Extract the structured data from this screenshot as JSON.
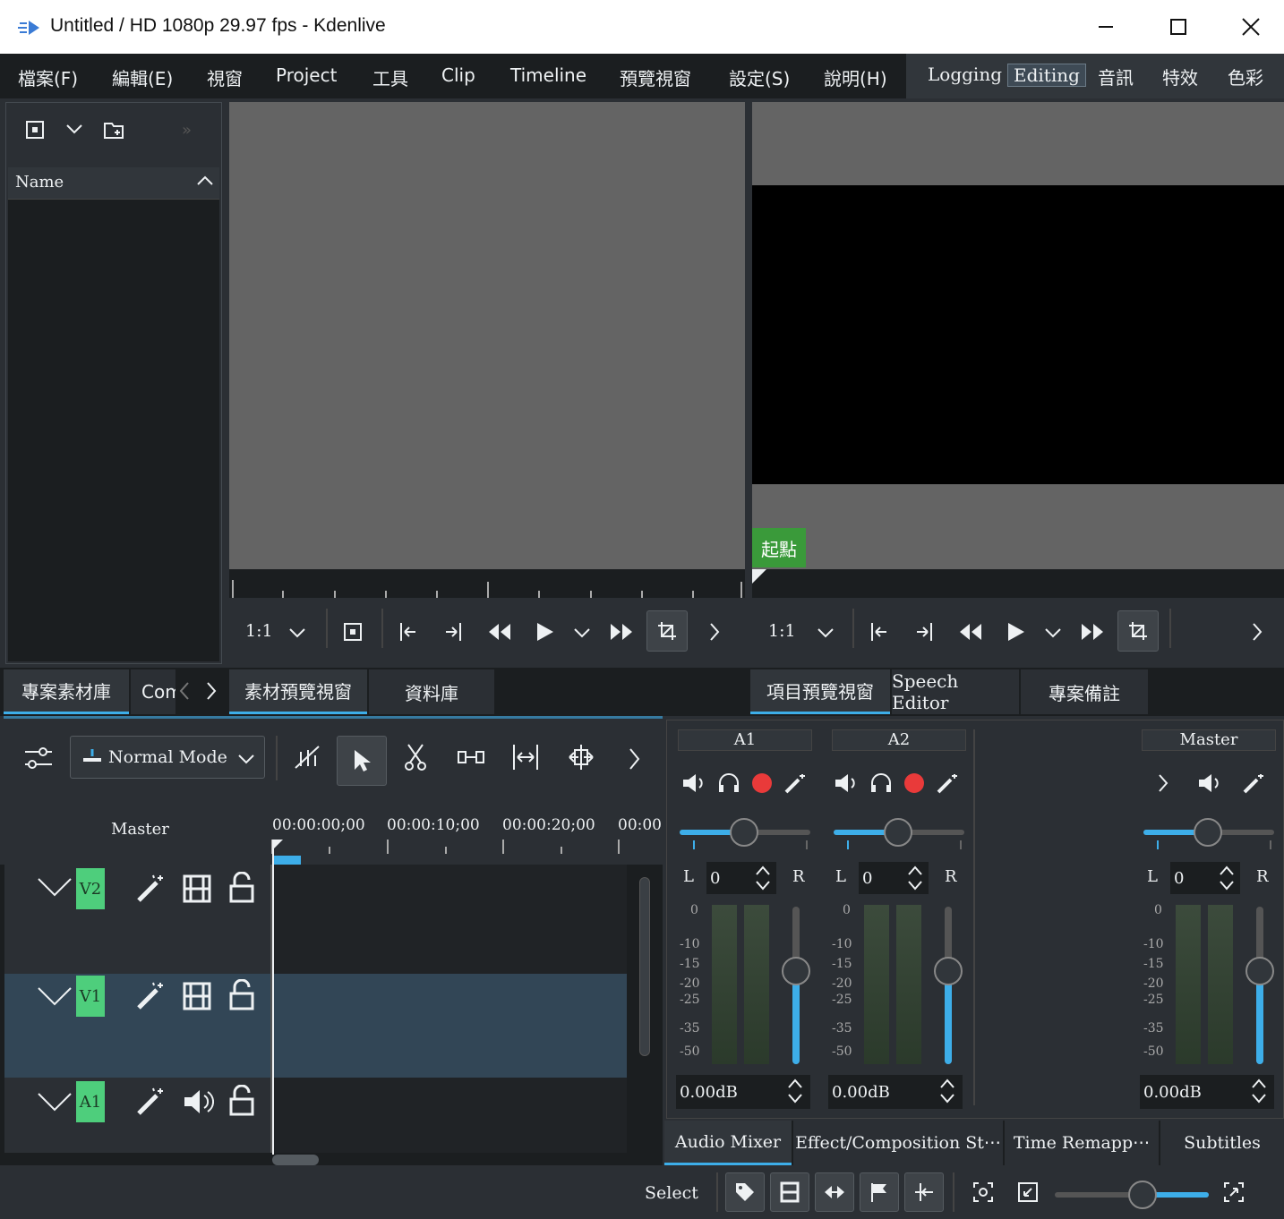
{
  "window": {
    "title": "Untitled / HD 1080p 29.97 fps - Kdenlive"
  },
  "menu": {
    "items": [
      "檔案(F)",
      "編輯(E)",
      "視窗",
      "Project",
      "工具",
      "Clip",
      "Timeline",
      "預覽視窗",
      "設定(S)",
      "說明(H)"
    ]
  },
  "layouts": {
    "items": [
      "Logging",
      "Editing",
      "音訊",
      "特效",
      "色彩"
    ],
    "active": "Editing"
  },
  "bin": {
    "column_name": "Name"
  },
  "clip_monitor": {
    "zoom": "1:1"
  },
  "project_monitor": {
    "zoom": "1:1",
    "marker": "起點"
  },
  "tabs_left": [
    "專案素材庫",
    "Com"
  ],
  "tabs_middle": [
    "素材預覽視窗",
    "資料庫"
  ],
  "tabs_right": [
    "項目預覽視窗",
    "Speech Editor",
    "專案備註"
  ],
  "timeline": {
    "mode": "Normal Mode",
    "master_label": "Master",
    "ruler": [
      "00:00:00;00",
      "00:00:10;00",
      "00:00:20;00",
      "00:00"
    ],
    "tracks": [
      {
        "name": "V2"
      },
      {
        "name": "V1"
      },
      {
        "name": "A1"
      }
    ]
  },
  "mixer": {
    "channels": [
      {
        "name": "A1",
        "pan": "0",
        "db": "0.00dB",
        "L": "L",
        "R": "R"
      },
      {
        "name": "A2",
        "pan": "0",
        "db": "0.00dB",
        "L": "L",
        "R": "R"
      },
      {
        "name": "Master",
        "pan": "0",
        "db": "0.00dB",
        "L": "L",
        "R": "R"
      }
    ],
    "scale": [
      "0",
      "-10",
      "-15",
      "-20",
      "-25",
      "-35",
      "-50"
    ]
  },
  "bottom_tabs": [
    "Audio Mixer",
    "Effect/Composition St⋯",
    "Time Remapp⋯",
    "Subtitles"
  ],
  "status": {
    "select": "Select"
  },
  "colors": {
    "accent": "#3daee9",
    "track_tag": "#4ece7c",
    "marker": "#3a9a3a",
    "record": "#e93a3a"
  }
}
